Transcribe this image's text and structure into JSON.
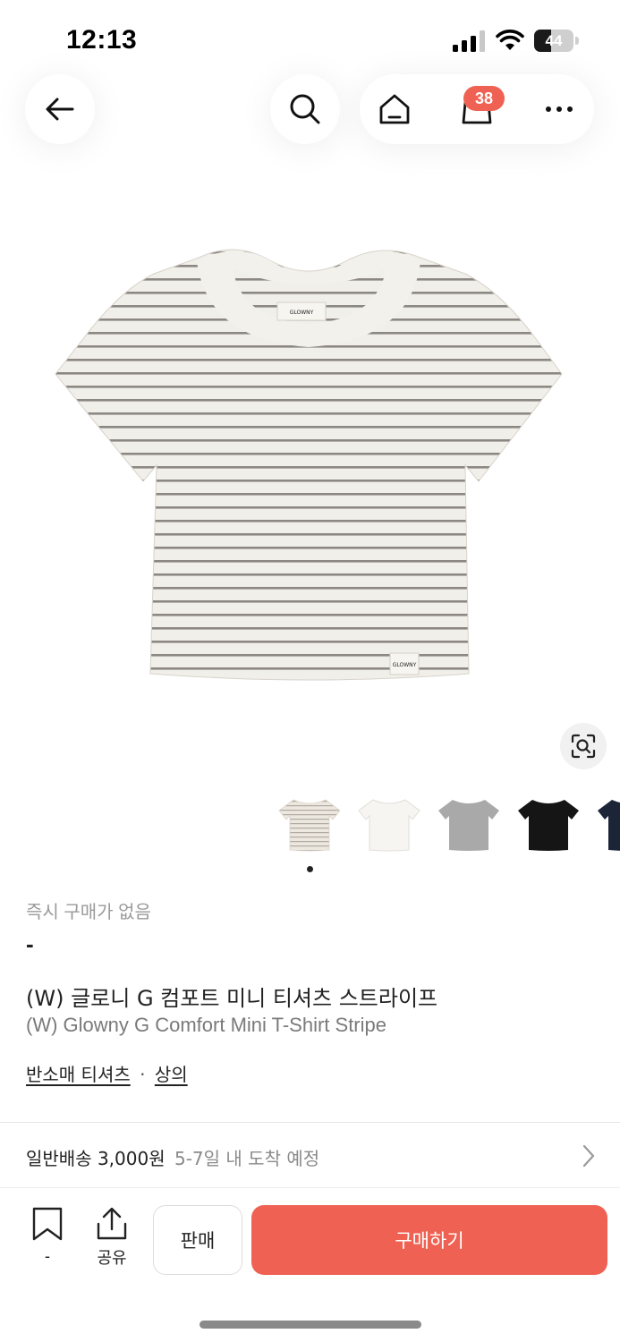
{
  "status_bar": {
    "time": "12:13",
    "battery": "44",
    "battery_level": 0.44
  },
  "header": {
    "cart_count": "38"
  },
  "icons": {
    "back": "arrow-left-icon",
    "search": "search-icon",
    "home": "home-icon",
    "cart": "shopping-bag-icon",
    "more": "more-horizontal-icon",
    "lens": "image-search-icon",
    "bookmark": "bookmark-icon",
    "share": "share-icon",
    "chevron": "chevron-right-icon"
  },
  "colors": {
    "accent": "#ef6253",
    "muted_text": "#9a9a9a"
  },
  "gallery": {
    "variants": [
      {
        "color": "stripe-beige"
      },
      {
        "color": "white"
      },
      {
        "color": "gray"
      },
      {
        "color": "black"
      },
      {
        "color": "navy"
      }
    ],
    "current_page": 1
  },
  "product": {
    "instant_label": "즉시 구매가 없음",
    "price": "-",
    "title_ko": "(W) 글로니 G 컴포트 미니 티셔츠 스트라이프",
    "title_en": "(W) Glowny G Comfort Mini T-Shirt Stripe",
    "category_sub": "반소매 티셔츠",
    "category_separator": "·",
    "category_main": "상의"
  },
  "shipping": {
    "label": "일반배송 3,000원",
    "eta": "5-7일 내 도착 예정"
  },
  "actions": {
    "bookmark_count": "-",
    "share_label": "공유",
    "sell_label": "판매",
    "buy_label": "구매하기"
  }
}
